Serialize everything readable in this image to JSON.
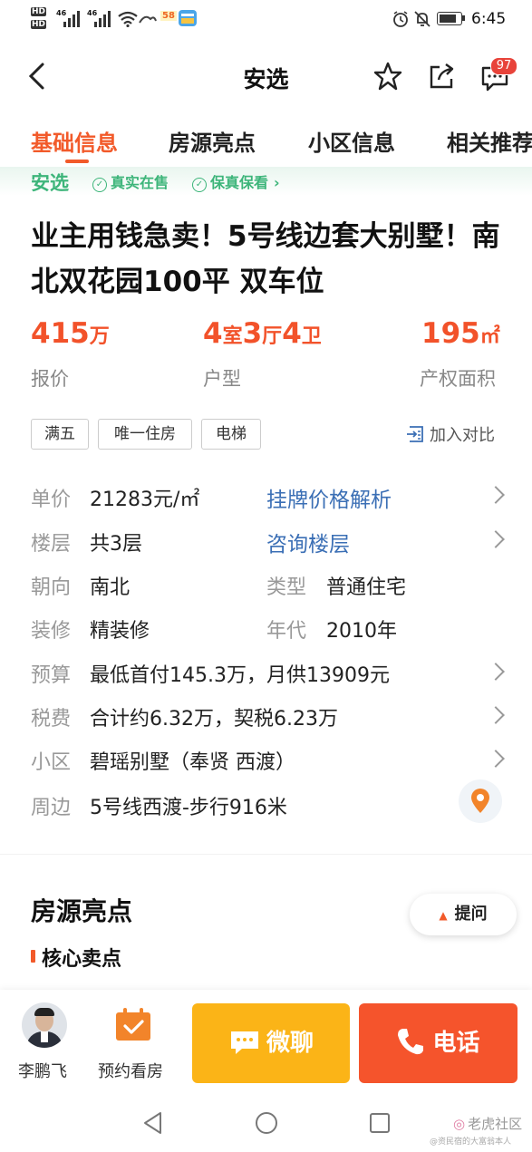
{
  "status_bar": {
    "hd1": "HD",
    "hd2": "HD",
    "sim1": "46",
    "sim2": "46",
    "badge": "58",
    "time": "6:45"
  },
  "nav": {
    "title": "安选",
    "message_count": "97"
  },
  "tabs": [
    {
      "label": "基础信息",
      "active": true
    },
    {
      "label": "房源亮点",
      "active": false
    },
    {
      "label": "小区信息",
      "active": false
    },
    {
      "label": "相关推荐",
      "active": false
    }
  ],
  "verify_bar": {
    "brand": "安选",
    "item1": "真实在售",
    "item2": "保真保看"
  },
  "listing": {
    "title": "业主用钱急卖！5号线边套大别墅！南北双花园100平 双车位",
    "price_value": "415",
    "price_unit": "万",
    "price_label": "报价",
    "layout_rooms": "4",
    "layout_rooms_unit": "室",
    "layout_halls": "3",
    "layout_halls_unit": "厅",
    "layout_baths": "4",
    "layout_baths_unit": "卫",
    "layout_label": "户型",
    "area_value": "195",
    "area_unit": "㎡",
    "area_label": "产权面积"
  },
  "tags": [
    "满五",
    "唯一住房",
    "电梯"
  ],
  "compare_label": "加入对比",
  "details": {
    "unit_price_label": "单价",
    "unit_price_value": "21283元/㎡",
    "price_analysis_link": "挂牌价格解析",
    "floor_label": "楼层",
    "floor_value": "共3层",
    "floor_link": "咨询楼层",
    "orientation_label": "朝向",
    "orientation_value": "南北",
    "type_label": "类型",
    "type_value": "普通住宅",
    "decoration_label": "装修",
    "decoration_value": "精装修",
    "year_label": "年代",
    "year_value": "2010年",
    "budget_label": "预算",
    "budget_value": "最低首付145.3万，月供13909元",
    "tax_label": "税费",
    "tax_value": "合计约6.32万，契税6.23万",
    "community_label": "小区",
    "community_value": "碧瑶别墅（奉贤 西渡）",
    "nearby_label": "周边",
    "nearby_value": "5号线西渡-步行916米"
  },
  "highlights": {
    "section_title": "房源亮点",
    "ask_label": "提问",
    "subsection": "核心卖点"
  },
  "bottom_bar": {
    "agent_name": "李鹏飞",
    "appointment_label": "预约看房",
    "chat_label": "微聊",
    "call_label": "电话",
    "chat_color": "#fbb417",
    "call_color": "#f5542c"
  },
  "watermark": {
    "line1": "老虎社区",
    "line2": "@资民宿的大富翁本人"
  },
  "colors": {
    "accent": "#f25a2a",
    "verify_green": "#3db57a",
    "link_blue": "#3b6fb5"
  }
}
